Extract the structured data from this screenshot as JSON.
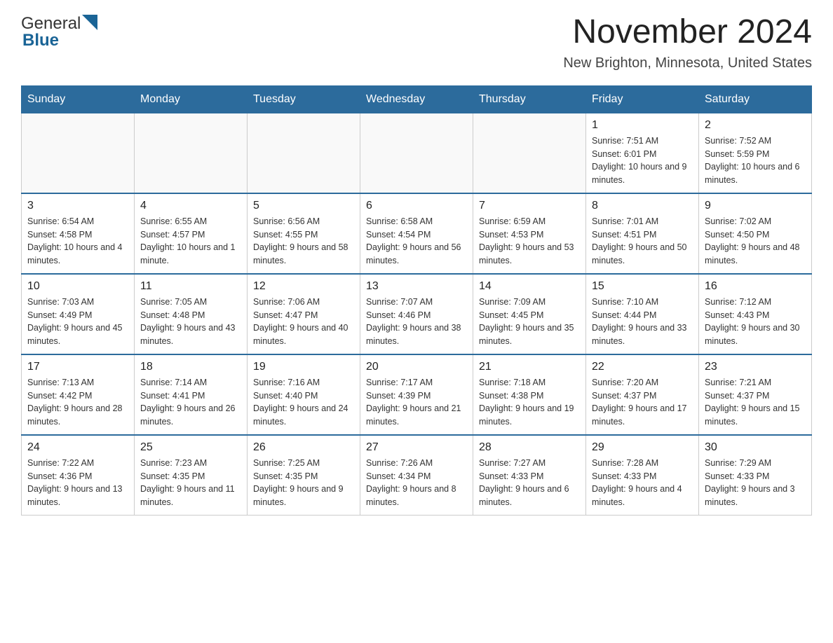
{
  "header": {
    "logo_general": "General",
    "logo_blue": "Blue",
    "month_title": "November 2024",
    "location": "New Brighton, Minnesota, United States"
  },
  "weekdays": [
    "Sunday",
    "Monday",
    "Tuesday",
    "Wednesday",
    "Thursday",
    "Friday",
    "Saturday"
  ],
  "weeks": [
    [
      {
        "day": "",
        "info": ""
      },
      {
        "day": "",
        "info": ""
      },
      {
        "day": "",
        "info": ""
      },
      {
        "day": "",
        "info": ""
      },
      {
        "day": "",
        "info": ""
      },
      {
        "day": "1",
        "info": "Sunrise: 7:51 AM\nSunset: 6:01 PM\nDaylight: 10 hours and 9 minutes."
      },
      {
        "day": "2",
        "info": "Sunrise: 7:52 AM\nSunset: 5:59 PM\nDaylight: 10 hours and 6 minutes."
      }
    ],
    [
      {
        "day": "3",
        "info": "Sunrise: 6:54 AM\nSunset: 4:58 PM\nDaylight: 10 hours and 4 minutes."
      },
      {
        "day": "4",
        "info": "Sunrise: 6:55 AM\nSunset: 4:57 PM\nDaylight: 10 hours and 1 minute."
      },
      {
        "day": "5",
        "info": "Sunrise: 6:56 AM\nSunset: 4:55 PM\nDaylight: 9 hours and 58 minutes."
      },
      {
        "day": "6",
        "info": "Sunrise: 6:58 AM\nSunset: 4:54 PM\nDaylight: 9 hours and 56 minutes."
      },
      {
        "day": "7",
        "info": "Sunrise: 6:59 AM\nSunset: 4:53 PM\nDaylight: 9 hours and 53 minutes."
      },
      {
        "day": "8",
        "info": "Sunrise: 7:01 AM\nSunset: 4:51 PM\nDaylight: 9 hours and 50 minutes."
      },
      {
        "day": "9",
        "info": "Sunrise: 7:02 AM\nSunset: 4:50 PM\nDaylight: 9 hours and 48 minutes."
      }
    ],
    [
      {
        "day": "10",
        "info": "Sunrise: 7:03 AM\nSunset: 4:49 PM\nDaylight: 9 hours and 45 minutes."
      },
      {
        "day": "11",
        "info": "Sunrise: 7:05 AM\nSunset: 4:48 PM\nDaylight: 9 hours and 43 minutes."
      },
      {
        "day": "12",
        "info": "Sunrise: 7:06 AM\nSunset: 4:47 PM\nDaylight: 9 hours and 40 minutes."
      },
      {
        "day": "13",
        "info": "Sunrise: 7:07 AM\nSunset: 4:46 PM\nDaylight: 9 hours and 38 minutes."
      },
      {
        "day": "14",
        "info": "Sunrise: 7:09 AM\nSunset: 4:45 PM\nDaylight: 9 hours and 35 minutes."
      },
      {
        "day": "15",
        "info": "Sunrise: 7:10 AM\nSunset: 4:44 PM\nDaylight: 9 hours and 33 minutes."
      },
      {
        "day": "16",
        "info": "Sunrise: 7:12 AM\nSunset: 4:43 PM\nDaylight: 9 hours and 30 minutes."
      }
    ],
    [
      {
        "day": "17",
        "info": "Sunrise: 7:13 AM\nSunset: 4:42 PM\nDaylight: 9 hours and 28 minutes."
      },
      {
        "day": "18",
        "info": "Sunrise: 7:14 AM\nSunset: 4:41 PM\nDaylight: 9 hours and 26 minutes."
      },
      {
        "day": "19",
        "info": "Sunrise: 7:16 AM\nSunset: 4:40 PM\nDaylight: 9 hours and 24 minutes."
      },
      {
        "day": "20",
        "info": "Sunrise: 7:17 AM\nSunset: 4:39 PM\nDaylight: 9 hours and 21 minutes."
      },
      {
        "day": "21",
        "info": "Sunrise: 7:18 AM\nSunset: 4:38 PM\nDaylight: 9 hours and 19 minutes."
      },
      {
        "day": "22",
        "info": "Sunrise: 7:20 AM\nSunset: 4:37 PM\nDaylight: 9 hours and 17 minutes."
      },
      {
        "day": "23",
        "info": "Sunrise: 7:21 AM\nSunset: 4:37 PM\nDaylight: 9 hours and 15 minutes."
      }
    ],
    [
      {
        "day": "24",
        "info": "Sunrise: 7:22 AM\nSunset: 4:36 PM\nDaylight: 9 hours and 13 minutes."
      },
      {
        "day": "25",
        "info": "Sunrise: 7:23 AM\nSunset: 4:35 PM\nDaylight: 9 hours and 11 minutes."
      },
      {
        "day": "26",
        "info": "Sunrise: 7:25 AM\nSunset: 4:35 PM\nDaylight: 9 hours and 9 minutes."
      },
      {
        "day": "27",
        "info": "Sunrise: 7:26 AM\nSunset: 4:34 PM\nDaylight: 9 hours and 8 minutes."
      },
      {
        "day": "28",
        "info": "Sunrise: 7:27 AM\nSunset: 4:33 PM\nDaylight: 9 hours and 6 minutes."
      },
      {
        "day": "29",
        "info": "Sunrise: 7:28 AM\nSunset: 4:33 PM\nDaylight: 9 hours and 4 minutes."
      },
      {
        "day": "30",
        "info": "Sunrise: 7:29 AM\nSunset: 4:33 PM\nDaylight: 9 hours and 3 minutes."
      }
    ]
  ]
}
